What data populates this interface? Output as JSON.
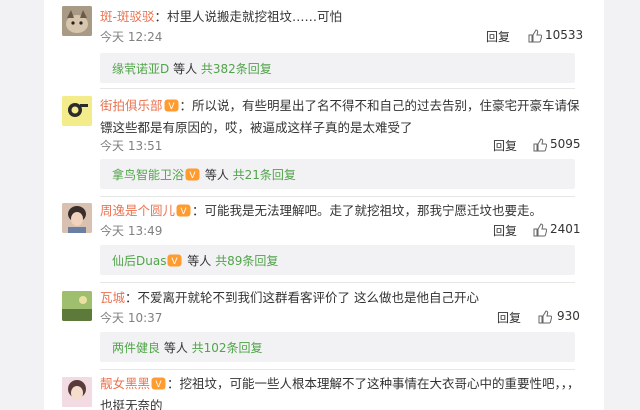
{
  "comments": [
    {
      "user": "斑-斑驳驳",
      "colon": "：",
      "text": "村里人说搬走就挖祖坟……可怕",
      "time": "今天 12:24",
      "reply_label": "回复",
      "likes": "10533",
      "vip": false,
      "reply_bar": {
        "user": "缘茕诺亚D",
        "middle": " 等人 ",
        "count": "共382条回复"
      }
    },
    {
      "user": "街拍俱乐部",
      "colon": "：",
      "text": "所以说，有些明星出了名不得不和自己的过去告别，住豪宅开豪车请保镖这些都是有原因的，哎，被逼成这样子真的是太难受了",
      "time": "今天 13:51",
      "reply_label": "回复",
      "likes": "5095",
      "vip": true,
      "reply_bar": {
        "user": "拿鸟智能卫浴",
        "middle": " 等人 ",
        "count": "共21条回复"
      }
    },
    {
      "user": "周逸是个圆儿",
      "colon": "：",
      "text": "可能我是无法理解吧。走了就挖祖坟，那我宁愿迁坟也要走。",
      "time": "今天 13:49",
      "reply_label": "回复",
      "likes": "2401",
      "vip": true,
      "reply_bar": {
        "user": "仙后Duas",
        "middle": " 等人 ",
        "count": "共89条回复"
      }
    },
    {
      "user": "瓦城",
      "colon": "：",
      "text": "不爱离开就轮不到我们这群看客评价了 这么做也是他自己开心",
      "time": "今天 10:37",
      "reply_label": "回复",
      "likes": "930",
      "vip": false,
      "reply_bar": {
        "user": "两件健良",
        "middle": " 等人 ",
        "count": "共102条回复"
      }
    },
    {
      "user": "靓女黑黑",
      "colon": "：",
      "text": "挖祖坟，可能一些人根本理解不了这种事情在大衣哥心中的重要性吧，，，也挺无奈的",
      "vip": true
    }
  ],
  "colors": {
    "username": "#eb7350",
    "reply_user": "#51a449",
    "meta": "#808080",
    "reply_bg": "#f2f2f5"
  }
}
